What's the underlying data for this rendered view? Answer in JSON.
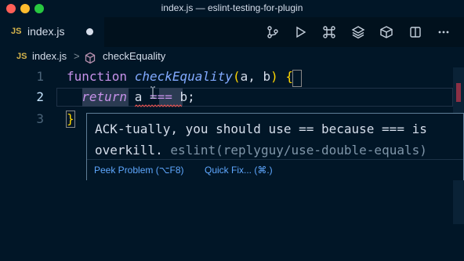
{
  "window": {
    "title": "index.js — eslint-testing-for-plugin"
  },
  "tab": {
    "lang": "JS",
    "name": "index.js"
  },
  "toolbar": {
    "icons": [
      "source-control-icon",
      "run-icon",
      "command-icon",
      "layers-icon",
      "box-icon",
      "split-editor-icon",
      "more-icon"
    ]
  },
  "breadcrumb": {
    "lang": "JS",
    "file": "index.js",
    "separator": ">",
    "symbol": "checkEquality"
  },
  "editor": {
    "lines": [
      {
        "number": "1",
        "keyword": "function",
        "name": "checkEquality",
        "open_paren": "(",
        "params": "a, b",
        "close_paren": ")",
        "brace": "{"
      },
      {
        "number": "2",
        "keyword": "return",
        "left": "a",
        "op": "===",
        "right": "b",
        "end": ";"
      },
      {
        "number": "3",
        "brace": "}"
      }
    ]
  },
  "hover": {
    "message_line1": "ACK-tually, you should use == because === is",
    "message_line2": "overkill.",
    "rule": "eslint(replyguy/use-double-equals)",
    "peek": "Peek Problem (⌥F8)",
    "quickfix": "Quick Fix... (⌘.)"
  },
  "colors": {
    "background": "#011627",
    "keyword": "#c792ea",
    "function": "#82aaff",
    "link": "#5fa8ff",
    "error": "#ef5350"
  }
}
